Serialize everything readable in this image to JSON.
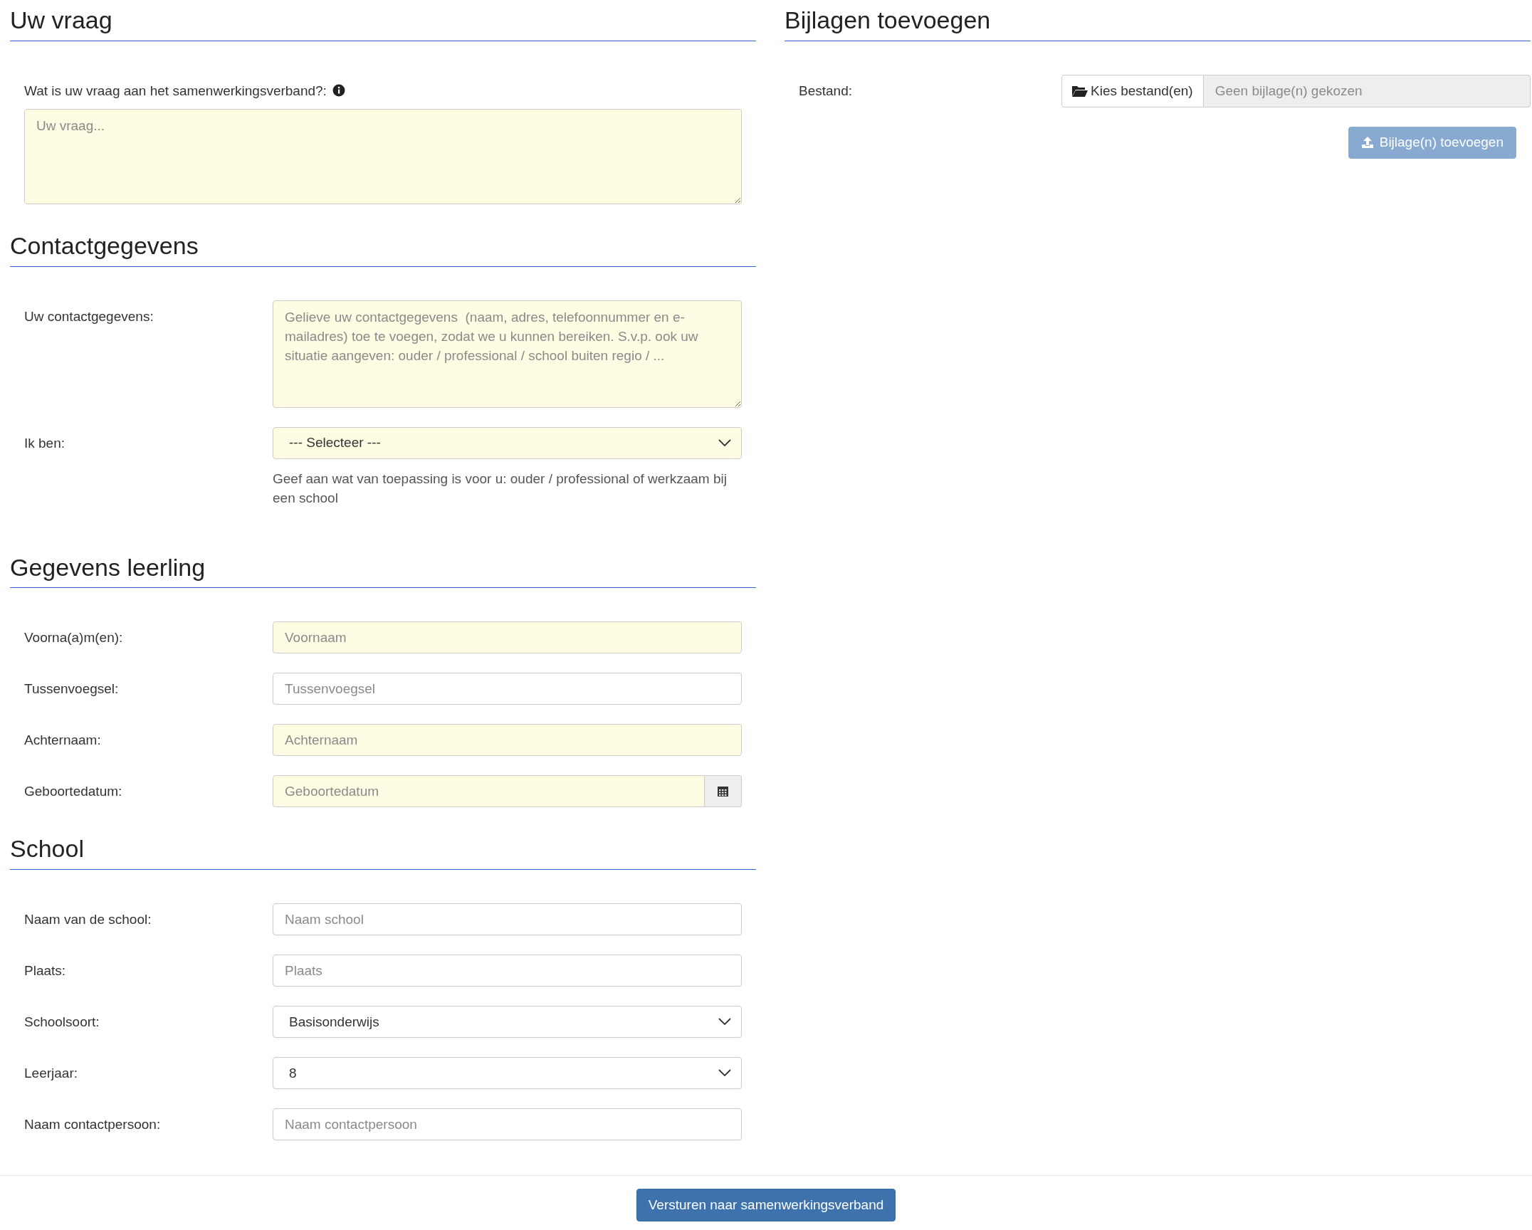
{
  "sections": [
    {
      "title": "Uw vraag",
      "fields": [
        {
          "kind": "textarea",
          "stacked": true,
          "label": "Wat is uw vraag aan het samenwerkingsverband?:",
          "info": true,
          "placeholder": "Uw vraag...",
          "required": true
        }
      ]
    },
    {
      "title": "Contactgegevens",
      "fields": [
        {
          "kind": "textarea",
          "stacked": false,
          "label": "Uw contactgegevens:",
          "info": false,
          "placeholder": "Gelieve uw contactgegevens  (naam, adres, telefoonnummer en e-mailadres) toe te voegen, zodat we u kunnen bereiken. S.v.p. ook uw situatie aangeven: ouder / professional / school buiten regio / ...",
          "required": true
        },
        {
          "kind": "select",
          "stacked": false,
          "label": "Ik ben:",
          "info": false,
          "value": "--- Selecteer ---",
          "required": true,
          "help": "Geef aan wat van toepassing is voor u: ouder / professional of werkzaam bij een school"
        }
      ]
    },
    {
      "title": "Gegevens leerling",
      "fields": [
        {
          "kind": "text",
          "stacked": false,
          "label": "Voorna(a)m(en):",
          "info": false,
          "placeholder": "Voornaam",
          "required": true
        },
        {
          "kind": "text",
          "stacked": false,
          "label": "Tussenvoegsel:",
          "info": false,
          "placeholder": "Tussenvoegsel",
          "required": false
        },
        {
          "kind": "text",
          "stacked": false,
          "label": "Achternaam:",
          "info": false,
          "placeholder": "Achternaam",
          "required": true
        },
        {
          "kind": "date",
          "stacked": false,
          "label": "Geboortedatum:",
          "info": false,
          "placeholder": "Geboortedatum",
          "required": true
        }
      ]
    },
    {
      "title": "School",
      "fields": [
        {
          "kind": "text",
          "stacked": false,
          "label": "Naam van de school:",
          "info": false,
          "placeholder": "Naam school",
          "required": false
        },
        {
          "kind": "text",
          "stacked": false,
          "label": "Plaats:",
          "info": false,
          "placeholder": "Plaats",
          "required": false
        },
        {
          "kind": "select",
          "stacked": false,
          "label": "Schoolsoort:",
          "info": false,
          "value": "Basisonderwijs",
          "required": false
        },
        {
          "kind": "select",
          "stacked": false,
          "label": "Leerjaar:",
          "info": false,
          "value": "8",
          "required": false
        },
        {
          "kind": "text",
          "stacked": false,
          "label": "Naam contactpersoon:",
          "info": false,
          "placeholder": "Naam contactpersoon",
          "required": false
        }
      ]
    }
  ],
  "attachments": {
    "title": "Bijlagen toevoegen",
    "label": "Bestand:",
    "choose_button": "Kies bestand(en)",
    "file_placeholder": "Geen bijlage(n) gekozen",
    "upload_button": {
      "label": "Bijlage(n) toevoegen",
      "disabled": true
    }
  },
  "submit_button": "Versturen naar samenwerkingsverband"
}
